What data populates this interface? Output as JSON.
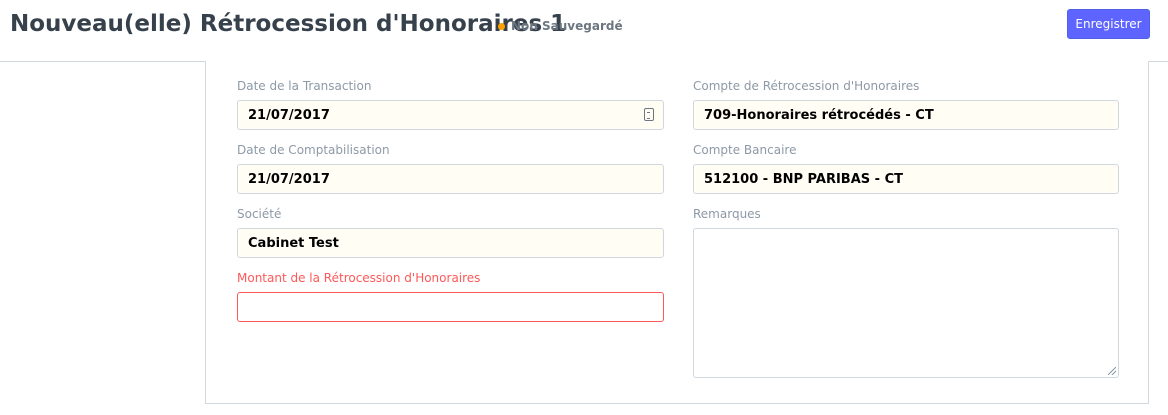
{
  "header": {
    "title": "Nouveau(elle) Rétrocession d'Honoraires 1",
    "status": "Non Sauvegardé",
    "save_label": "Enregistrer"
  },
  "colors": {
    "accent": "#5e64ff",
    "status_dot": "#ff9f00",
    "error": "#ff5858"
  },
  "form": {
    "transaction_date": {
      "label": "Date de la Transaction",
      "value": "21/07/2017",
      "icon": "calendar-icon"
    },
    "posting_date": {
      "label": "Date de Comptabilisation",
      "value": "21/07/2017"
    },
    "company": {
      "label": "Société",
      "value": "Cabinet Test"
    },
    "amount": {
      "label": "Montant de la Rétrocession d'Honoraires",
      "value": ""
    },
    "fee_account": {
      "label": "Compte de Rétrocession d'Honoraires",
      "value": "709-Honoraires rétrocédés - CT"
    },
    "bank_account": {
      "label": "Compte Bancaire",
      "value": "512100 - BNP PARIBAS - CT"
    },
    "remarks": {
      "label": "Remarques",
      "value": ""
    }
  }
}
